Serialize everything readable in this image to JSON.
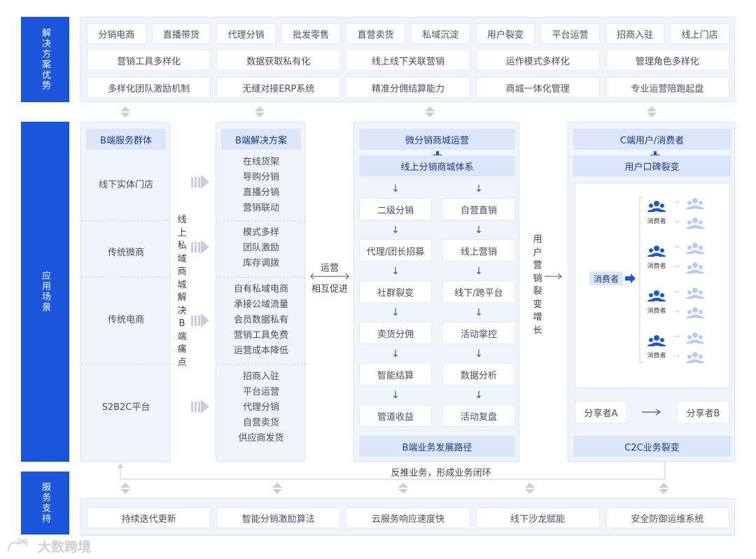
{
  "sections": {
    "top": "解决方案优势",
    "middle": "应用场景",
    "bottom": "服务支持"
  },
  "advantages": {
    "row1": [
      "分销电商",
      "直播带货",
      "代理分销",
      "批发零售",
      "直营卖货",
      "私域沉淀",
      "用户裂变",
      "平台运营",
      "招商入驻",
      "线上门店"
    ],
    "row2": [
      "营销工具多样化",
      "数据获取私有化",
      "线上线下关联营销",
      "运作模式多样化",
      "管理角色多样化"
    ],
    "row3": [
      "多样化团队激励机制",
      "无缝对接ERP系统",
      "精准分佣结算能力",
      "商城一体化管理",
      "专业运营陪跑起盘"
    ]
  },
  "b_groups": {
    "title": "B端服务群体",
    "items": [
      "线下实体门店",
      "传统微商",
      "传统电商",
      "S2B2C平台"
    ]
  },
  "pain_points_vertical": "线上私域商城解决B端痛点",
  "b_solutions": {
    "title": "B端解决方案",
    "groups": [
      [
        "在线货架",
        "导购分销",
        "直播分销",
        "营销联动"
      ],
      [
        "模式多样",
        "团队激励",
        "库存调拨"
      ],
      [
        "自有私域电商",
        "承接公域流量",
        "会员数据私有",
        "营销工具免费",
        "运营成本降低"
      ],
      [
        "招商入驻",
        "平台运营",
        "代理分销",
        "自营卖货",
        "供应商发货"
      ]
    ]
  },
  "mutual": {
    "line1": "运营",
    "line2": "相互促进"
  },
  "micro": {
    "title": "微分销商城运营",
    "subtitle": "线上分销商城体系",
    "left": [
      "二级分销",
      "代理/团长招募",
      "社群裂变",
      "卖货分佣",
      "智能结算",
      "管道收益"
    ],
    "right": [
      "自营直销",
      "线上营销",
      "线下/跨平台",
      "活动掌控",
      "数据分析",
      "活动复盘"
    ],
    "footer": "B端业务发展路径"
  },
  "growth_vertical": "用户营销裂变增长",
  "c_side": {
    "title": "C端用户/消费者",
    "subtitle": "用户口碑裂变",
    "consumer": "消费者",
    "node_label": "消费者",
    "sharer_a": "分享者A",
    "sharer_b": "分享者B",
    "footer": "C2C业务裂变"
  },
  "feedback": "反推业务，形成业务闭环",
  "services": [
    "持续迭代更新",
    "智能分销激励算法",
    "云服务响应速度快",
    "线下沙龙赋能",
    "安全防御运维系统"
  ],
  "watermark": "大数跨境",
  "colors": {
    "primary": "#1a56db",
    "header_bg": "#dbe6fb",
    "panel_bg": "#f0f4fb"
  }
}
